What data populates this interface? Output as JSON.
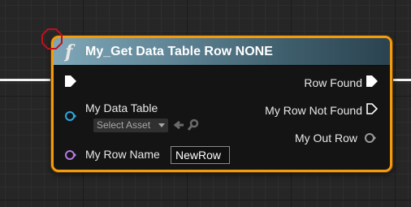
{
  "node": {
    "icon": "function-icon",
    "title": "My_Get Data Table Row NONE"
  },
  "inputs": {
    "exec_icon": "exec-in-icon",
    "data_table": {
      "label": "My Data Table",
      "asset_picker": "Select Asset",
      "icons": [
        "use-selected-arrow-icon",
        "browse-magnifier-icon"
      ]
    },
    "row_name": {
      "label": "My Row Name",
      "value": "NewRow"
    }
  },
  "outputs": {
    "row_found": "Row Found",
    "row_not_found": "My Row Not Found",
    "out_row": "My Out Row"
  },
  "colors": {
    "selection_border": "#f29b10",
    "header_start": "#7fa7b8",
    "header_end": "#2b4350",
    "data_table_pin": "#2aa9e0",
    "row_name_pin": "#b47ae0",
    "exec_pin": "#ffffff",
    "breakpoint_marker": "#c0101c"
  }
}
